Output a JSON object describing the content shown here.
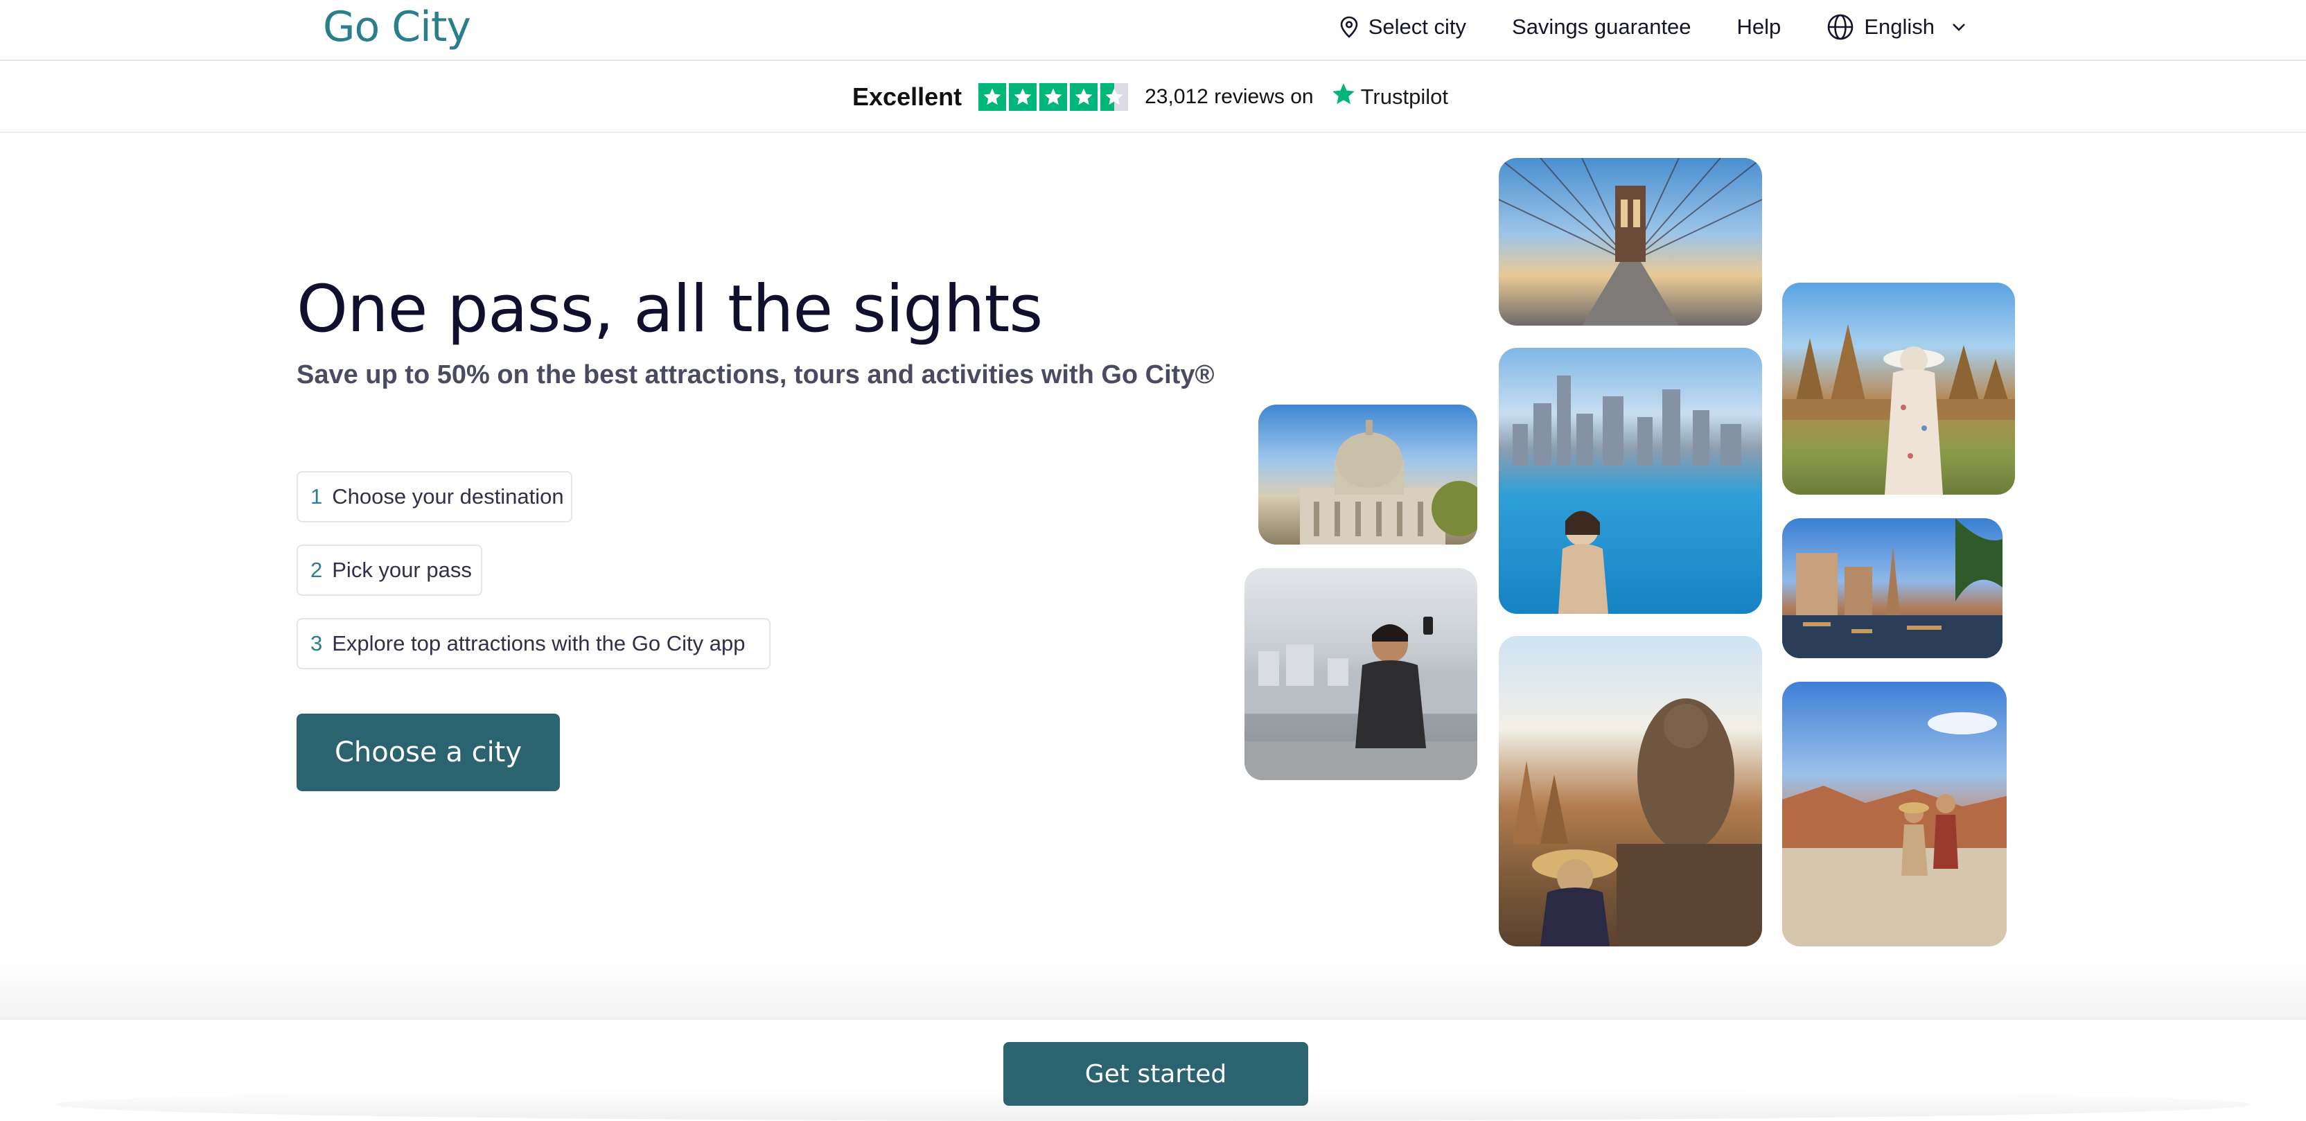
{
  "brand": {
    "logo_text": "Go City"
  },
  "nav": {
    "select_city": "Select city",
    "savings_guarantee": "Savings guarantee",
    "help": "Help",
    "language": "English"
  },
  "trustpilot": {
    "rating_word": "Excellent",
    "stars": 4.5,
    "review_count": "23,012",
    "reviews_on": "reviews on",
    "brand": "Trustpilot",
    "color": "#00b67a"
  },
  "hero": {
    "title": "One pass, all the sights",
    "subtitle": "Save up to 50% on the best attractions, tours and activities with Go City®",
    "steps": [
      {
        "num": "1",
        "label": "Choose your destination"
      },
      {
        "num": "2",
        "label": "Pick your pass"
      },
      {
        "num": "3",
        "label": "Explore top attractions with the Go City app"
      }
    ],
    "cta_label": "Choose a city"
  },
  "bottom": {
    "cta_label": "Get started"
  },
  "colors": {
    "primary": "#2b6470",
    "accent": "#2a7f8c",
    "logo_dot": "#e4573d"
  }
}
